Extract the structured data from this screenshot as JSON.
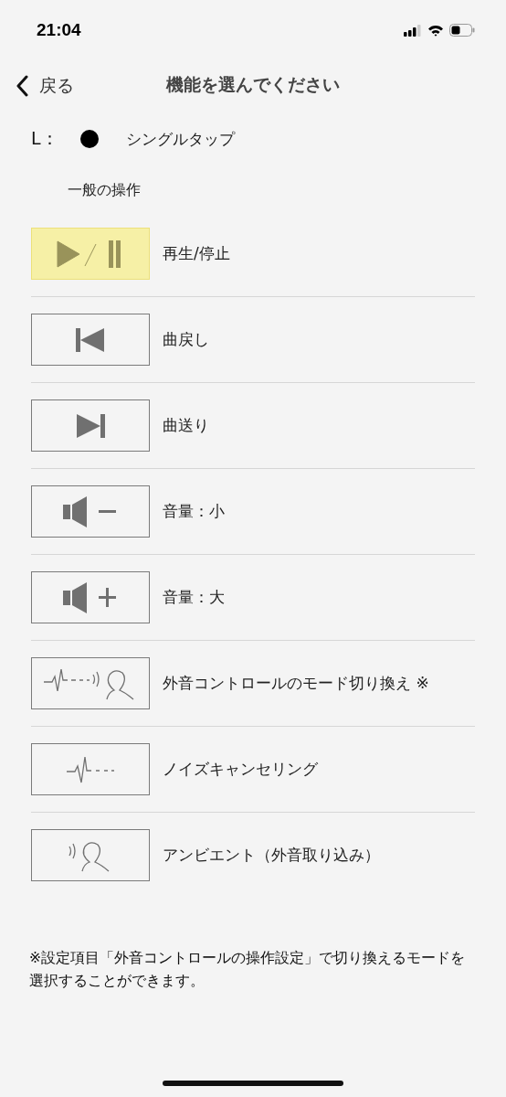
{
  "status_bar": {
    "time": "21:04"
  },
  "nav": {
    "back": "戻る",
    "title": "機能を選んでください"
  },
  "gesture": {
    "side": "L：",
    "label": "シングルタップ"
  },
  "section": "一般の操作",
  "functions": [
    {
      "kind": "play-pause",
      "label": "再生/停止",
      "selected": true
    },
    {
      "kind": "previous",
      "label": "曲戻し",
      "selected": false
    },
    {
      "kind": "next",
      "label": "曲送り",
      "selected": false
    },
    {
      "kind": "volume-down",
      "label": "音量：小",
      "selected": false
    },
    {
      "kind": "volume-up",
      "label": "音量：大",
      "selected": false
    },
    {
      "kind": "sound-mode",
      "label": "外音コントロールのモード切り換え ※",
      "selected": false
    },
    {
      "kind": "noise-cancel",
      "label": "ノイズキャンセリング",
      "selected": false
    },
    {
      "kind": "ambient",
      "label": "アンビエント（外音取り込み）",
      "selected": false
    }
  ],
  "note": "※設定項目「外音コントロールの操作設定」で切り換えるモードを選択することができます。"
}
